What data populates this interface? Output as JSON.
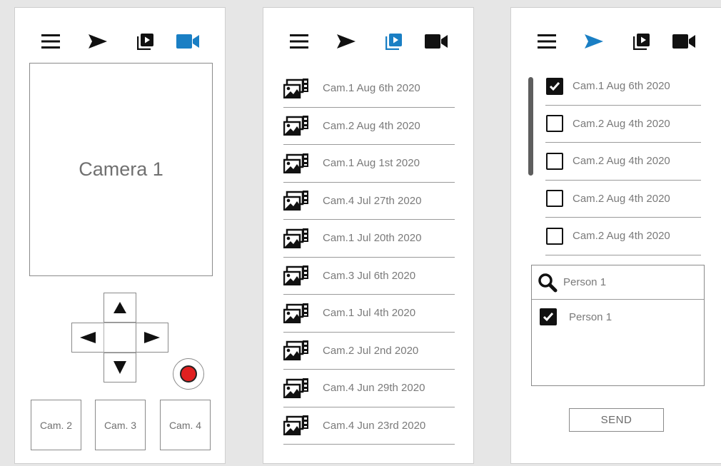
{
  "colors": {
    "accent": "#1a7fc4",
    "icon": "#111111",
    "record": "#e02020"
  },
  "icons": {
    "menu": "hamburger-menu-icon",
    "send": "send-arrow-icon",
    "playlist": "video-playlist-icon",
    "camera": "video-camera-icon",
    "media": "media-files-icon",
    "search": "search-icon"
  },
  "live": {
    "active_tab": "camera",
    "viewer_label": "Camera 1",
    "dpad": {
      "up": "up-arrow-icon",
      "down": "down-arrow-icon",
      "left": "left-arrow-icon",
      "right": "right-arrow-icon"
    },
    "cameras": [
      "Cam. 2",
      "Cam. 3",
      "Cam. 4"
    ]
  },
  "recordings": {
    "active_tab": "playlist",
    "items": [
      "Cam.1 Aug 6th 2020",
      "Cam.2 Aug 4th 2020",
      "Cam.1 Aug 1st 2020",
      "Cam.4 Jul 27th 2020",
      "Cam.1 Jul 20th 2020",
      "Cam.3 Jul 6th 2020",
      "Cam.1 Jul 4th 2020",
      "Cam.2 Jul 2nd 2020",
      "Cam.4 Jun 29th 2020",
      "Cam.4 Jun 23rd 2020"
    ]
  },
  "share": {
    "active_tab": "send",
    "items": [
      {
        "label": "Cam.1 Aug 6th 2020",
        "checked": true
      },
      {
        "label": "Cam.2 Aug 4th 2020",
        "checked": false
      },
      {
        "label": "Cam.2 Aug 4th 2020",
        "checked": false
      },
      {
        "label": "Cam.2 Aug 4th 2020",
        "checked": false
      },
      {
        "label": "Cam.2 Aug 4th 2020",
        "checked": false
      }
    ],
    "search_value": "Person 1",
    "results": [
      {
        "label": "Person 1",
        "checked": true
      }
    ],
    "send_label": "SEND"
  }
}
